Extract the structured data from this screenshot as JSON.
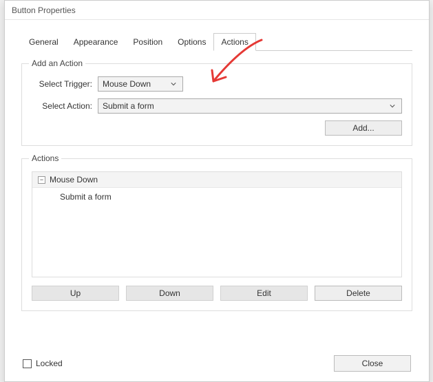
{
  "window": {
    "title": "Button Properties"
  },
  "tabs": [
    {
      "label": "General"
    },
    {
      "label": "Appearance"
    },
    {
      "label": "Position"
    },
    {
      "label": "Options"
    },
    {
      "label": "Actions"
    }
  ],
  "addAction": {
    "legend": "Add an Action",
    "triggerLabel": "Select Trigger:",
    "triggerValue": "Mouse Down",
    "actionLabel": "Select Action:",
    "actionValue": "Submit a form",
    "addButton": "Add..."
  },
  "actions": {
    "legend": "Actions",
    "tree": {
      "parent": "Mouse Down",
      "child": "Submit a form"
    },
    "buttons": {
      "up": "Up",
      "down": "Down",
      "edit": "Edit",
      "delete": "Delete"
    }
  },
  "footer": {
    "locked": "Locked",
    "close": "Close"
  }
}
